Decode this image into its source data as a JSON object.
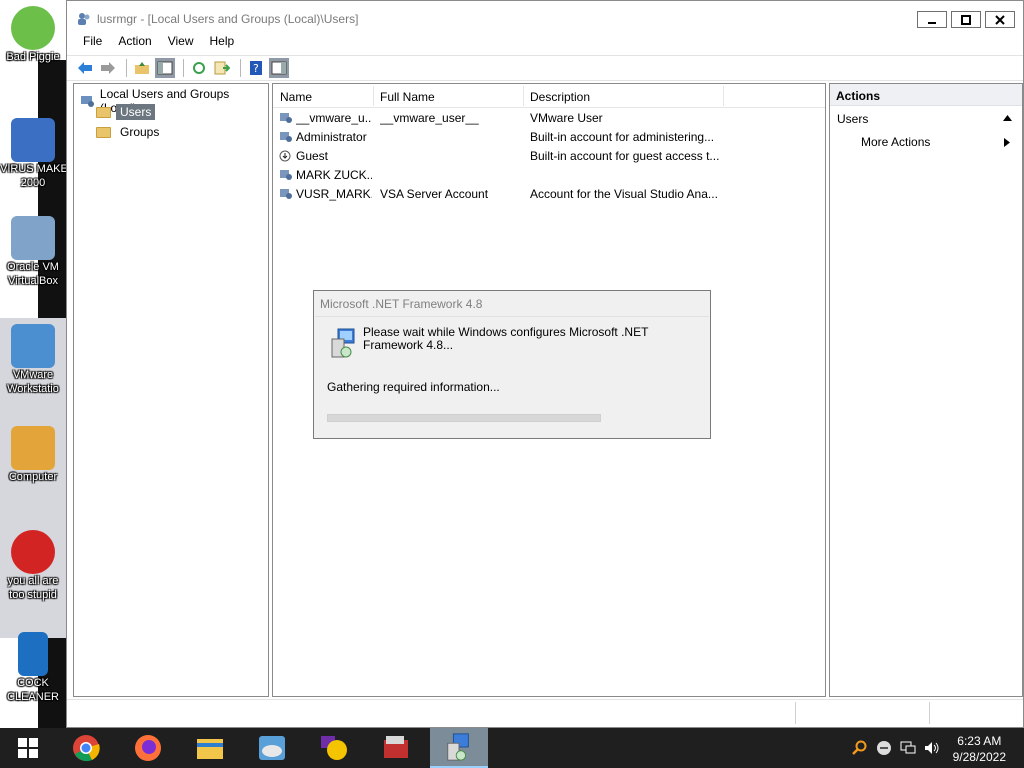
{
  "desktop": {
    "icons": [
      {
        "label1": "Bad Piggie",
        "label2": ""
      },
      {
        "label1": "VIRUS MAKE",
        "label2": "2000"
      },
      {
        "label1": "Oracle VM",
        "label2": "VirtualBox"
      },
      {
        "label1": "VMware",
        "label2": "Workstatio"
      },
      {
        "label1": "Computer",
        "label2": ""
      },
      {
        "label1": "you all are",
        "label2": "too stupid"
      },
      {
        "label1": "COCK",
        "label2": "CLEANER"
      }
    ]
  },
  "window": {
    "title": "lusrmgr - [Local Users and Groups (Local)\\Users]",
    "menu": [
      "File",
      "Action",
      "View",
      "Help"
    ]
  },
  "tree": {
    "root": "Local Users and Groups (Local)",
    "children": [
      "Users",
      "Groups"
    ]
  },
  "list": {
    "columns": [
      "Name",
      "Full Name",
      "Description"
    ],
    "rows": [
      {
        "name": "__vmware_u...",
        "full_name": "__vmware_user__",
        "description": "VMware User"
      },
      {
        "name": "Administrator",
        "full_name": "",
        "description": "Built-in account for administering..."
      },
      {
        "name": "Guest",
        "full_name": "",
        "description": "Built-in account for guest access t..."
      },
      {
        "name": "MARK ZUCK...",
        "full_name": "",
        "description": ""
      },
      {
        "name": "VUSR_MARK...",
        "full_name": "VSA Server Account",
        "description": "Account for the Visual Studio Ana..."
      }
    ]
  },
  "actions": {
    "header": "Actions",
    "section": "Users",
    "more": "More Actions"
  },
  "dialog": {
    "title": "Microsoft .NET Framework 4.8",
    "message": "Please wait while Windows configures Microsoft .NET Framework 4.8...",
    "status": "Gathering required information...",
    "progress": 0
  },
  "taskbar": {
    "time": "6:23 AM",
    "date": "9/28/2022"
  }
}
